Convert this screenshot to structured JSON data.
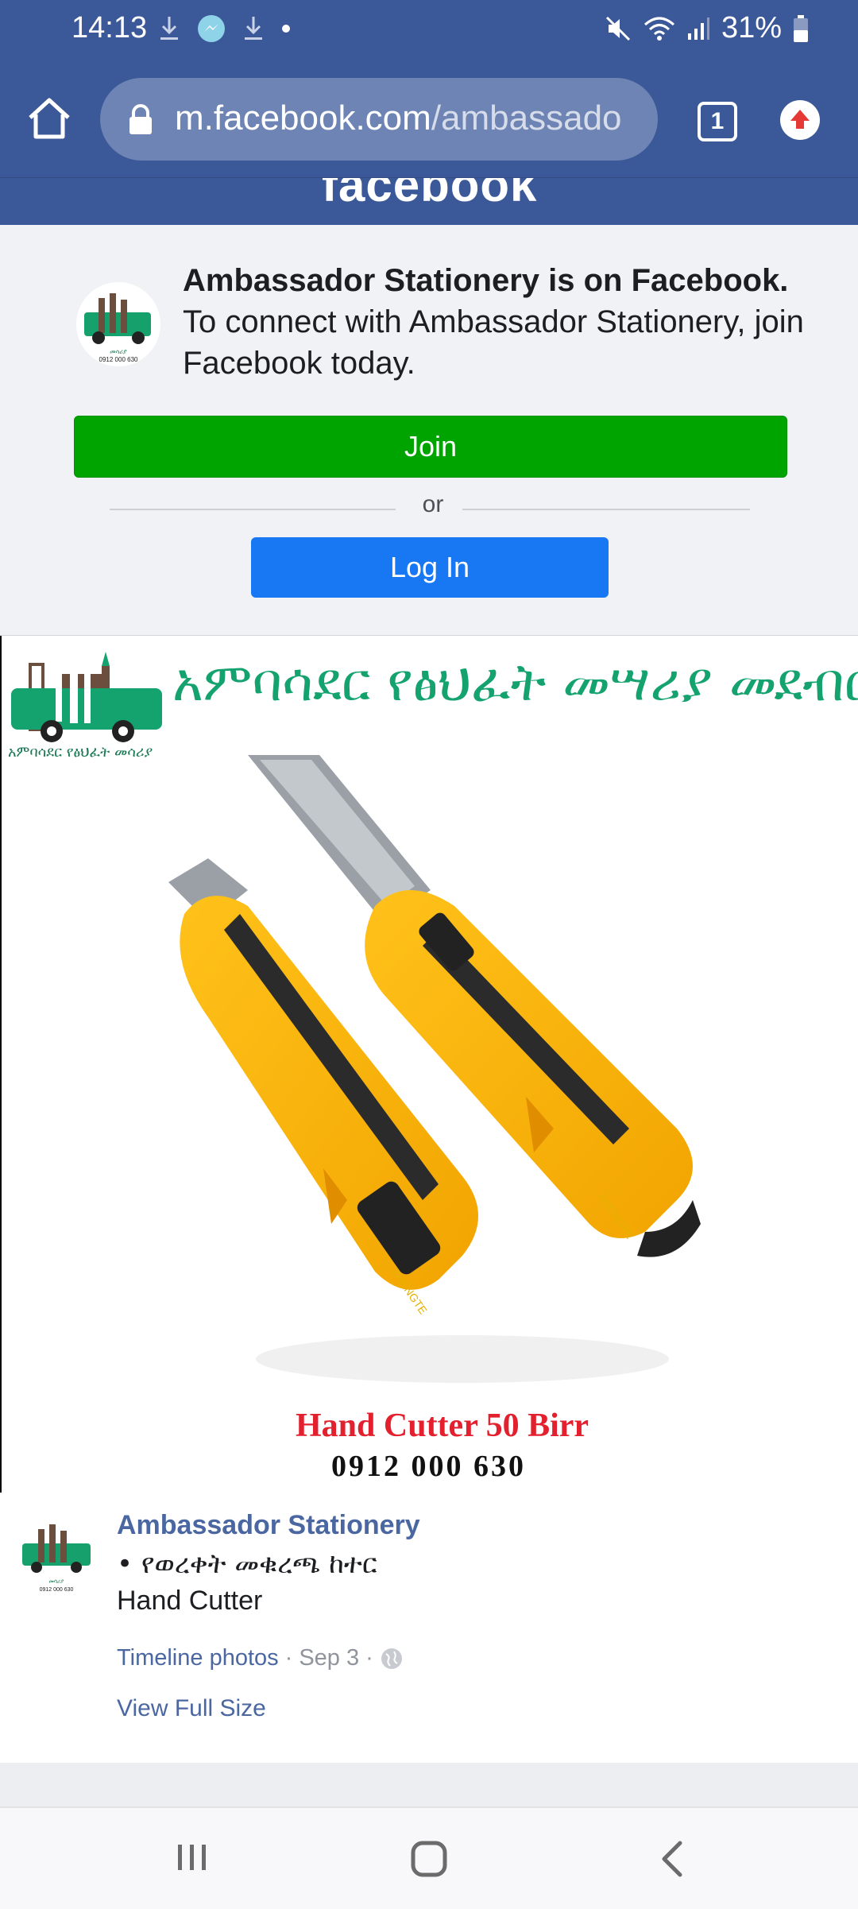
{
  "status_bar": {
    "time": "14:13",
    "battery": "31%"
  },
  "browser": {
    "url_host": "m.facebook.com",
    "url_path": "/ambassado",
    "tab_count": "1"
  },
  "facebook_banner": {
    "logo_text": "facebook"
  },
  "join_panel": {
    "headline": "Ambassador Stationery is on Facebook.",
    "subtext": "To connect with Ambassador Stationery, join Facebook today.",
    "join_label": "Join",
    "or_label": "or",
    "login_label": "Log In"
  },
  "post_image": {
    "amharic_title": "አምባሳደር የፅህፈት መሣሪያ መደብር",
    "logo_caption": "አምባሳደር የፅህፈት መሳሪያ",
    "price_text": "Hand Cutter  50 Birr",
    "phone_text": "0912 000 630",
    "avatar_phone": "0912 000 630",
    "blade_brand": "ZHENGTE"
  },
  "post": {
    "page_name": "Ambassador Stationery",
    "caption_line1": "• የወረቀት መቁረጫ ከተር",
    "caption_line2": "Hand Cutter",
    "source_label": "Timeline photos",
    "date": "Sep 3",
    "view_full_label": "View Full Size"
  },
  "colors": {
    "facebook_blue": "#3b5998",
    "join_green": "#00a400",
    "login_blue": "#1877f2",
    "brand_green": "#14a36e",
    "price_red": "#e3202e"
  }
}
